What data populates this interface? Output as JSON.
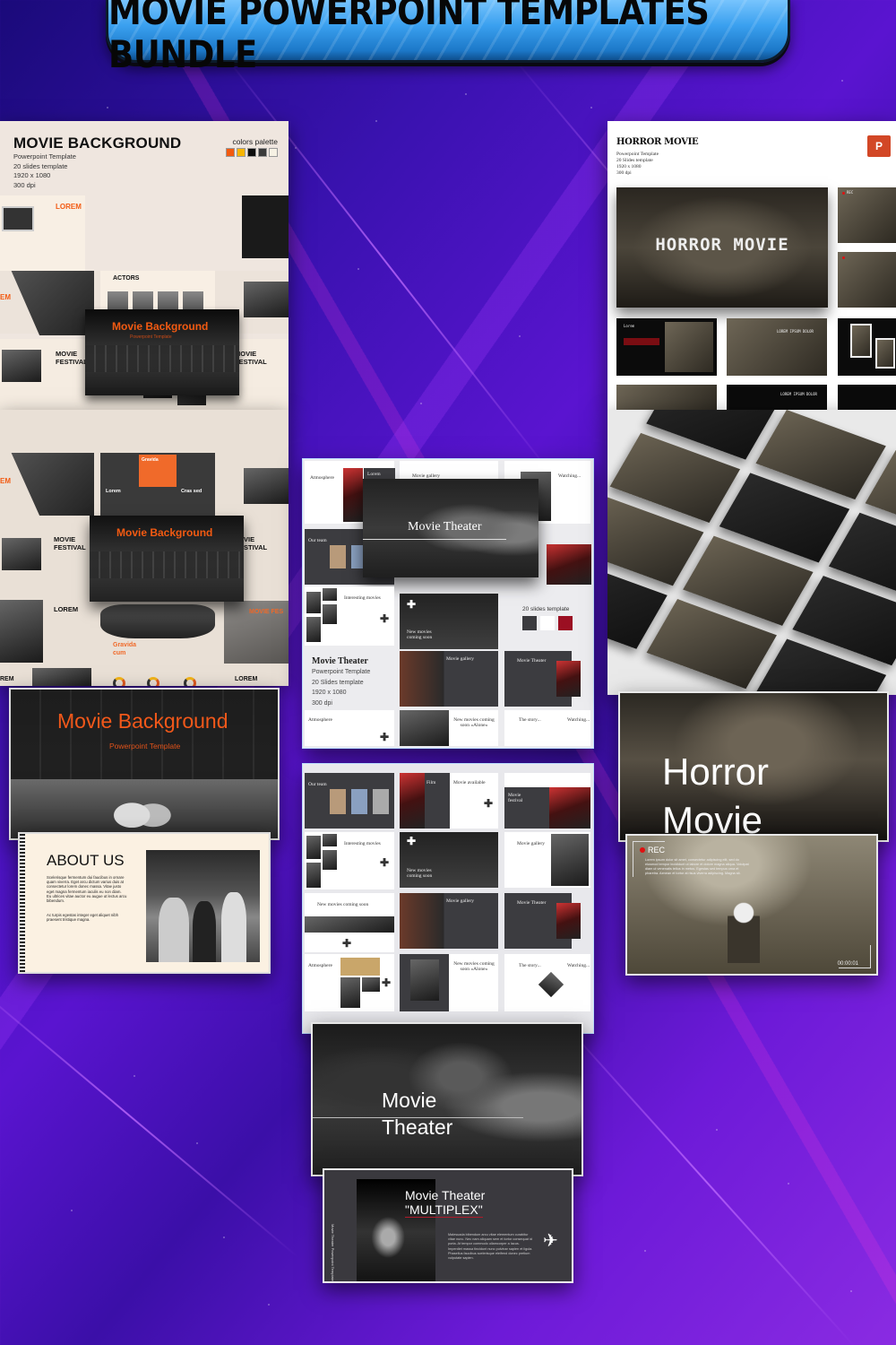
{
  "banner": {
    "title": "MOVIE POWERPOINT TEMPLATES BUNDLE"
  },
  "movie_background": {
    "cover": {
      "title": "MOVIE BACKGROUND",
      "details": [
        "Powerpoint Template",
        "20 slides template",
        "1920 x 1080",
        "300 dpi"
      ],
      "palette_label": "colors palette",
      "palette": [
        "#f25a0f",
        "#f7b500",
        "#0d0d0d",
        "#3a3a3a",
        "#f6f1e4"
      ],
      "hero_title": "Movie Background",
      "hero_subtitle": "Powerpoint Template",
      "lorem": "LOREM",
      "lem": "EM",
      "actors": "ACTORS",
      "festival": "MOVIE FESTIVAL"
    },
    "collage": {
      "gravida": "Gravida",
      "lorem": "Lorem",
      "cras": "Cras sed",
      "hero_title": "Movie Background",
      "festival_left": "MOVIE FESTIVAL",
      "festival_right": "VIE STIVAL",
      "lorem_big": "LOREM",
      "gravida_cum": "Gravida cum",
      "movie_fest": "MOVIE FES",
      "rem": "REM",
      "lorem_bottom": "LOREM"
    },
    "title_slide": {
      "title": "Movie Background",
      "subtitle": "Powerpoint Template"
    },
    "about": {
      "title": "ABOUT US",
      "para1": "Scelerisque fermentum dui faucibus in ornare quam viverra. Eget arcu dictum varius duis at consectetur lorem donec massa. Vitae justo eget magna fermentum iaculis eu non diam. Eu ultrices vitae auctor eu augue ut lectus arcu bibendum.",
      "para2": "Ac turpis egestas integer eget aliquet nibh praesent tristique magna."
    }
  },
  "movie_theater": {
    "board": {
      "atmosphere": "Atmosphere",
      "lorem": "Lorem",
      "gallery": "Movie gallery",
      "watching": "Watching...",
      "hero_title": "Movie Theater",
      "our_team": "Our team",
      "interesting": "Interesting movies",
      "coming": "New movies coming soon",
      "slides_label": "20 slides template",
      "palette": [
        "#3b3b3f",
        "#ffffff",
        "#9b0f22"
      ],
      "info_title": "Movie Theater",
      "info_details": [
        "Powerpoint Template",
        "20 Slides template",
        "1920 x 1080",
        "300 dpi"
      ],
      "gallery2": "Movie gallery",
      "theater_dark": "Movie Theater",
      "atmosphere2": "Atmosphere",
      "coming_alone": "New movies coming soon «Alone»",
      "story": "The story...",
      "watching2": "Watching..."
    },
    "board2": {
      "our_team": "Our team",
      "film": "Film",
      "available": "Movie available",
      "festival": "Movie festival",
      "interesting": "Interesting movies",
      "coming": "New movies coming soon",
      "gallery": "Movie gallery",
      "coming_strip": "New movies coming soon",
      "gallery2": "Movie gallery",
      "theater": "Movie Theater",
      "atmosphere": "Atmosphere",
      "coming_alone": "New movies coming soon «Alone»",
      "story": "The story...",
      "watching": "Watching..."
    },
    "title_slide": {
      "line1": "Movie",
      "line2": "Theater"
    },
    "multiplex": {
      "title1": "Movie Theater",
      "title2": "\"MULTIPLEX\"",
      "vertical": "Movie Theater Powerpoint Template",
      "body": "Malesuada bibendum arcu vitae elementum curabitur vitae nunc. Nec nam aliquam sem et tortor consequat id porta. At tempor commodo ullamcorper a lacus. Imperdiet massa tincidunt nunc pulvinar sapien et ligula. Phasellus faucibus scelerisque eleifend donec pretium vulputate sapien."
    }
  },
  "horror_movie": {
    "cover": {
      "logo": "HORROR MOVIE",
      "details": [
        "Powerpoint Template",
        "20 Slides template",
        "1920 x 1080",
        "300 dpi"
      ],
      "ppt_icon": "P",
      "hero_title": "HORROR MOVIE",
      "thumb_rec": "REC",
      "thumb_lorem": "Lorem",
      "thumb_caption": "LOREM IPSUM DOLOR"
    },
    "title_slide": {
      "line1": "Horror",
      "line2": "Movie"
    },
    "rec_slide": {
      "rec": "REC",
      "text": "Lorem ipsum dolor sit amet, consectetur adipiscing elit, sed do eiusmod tempor incididunt ut labore et dolore magna aliqua. Volutpat diam ut venenatis tellus in metus. Egestas sed tempus urna et pharetra. Aenean et tortor at risus viverra adipiscing. Magna sit.",
      "timecode": "00:00:01"
    }
  }
}
